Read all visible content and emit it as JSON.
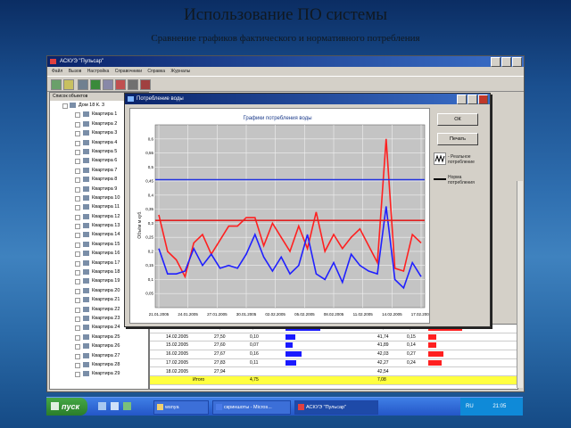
{
  "slide": {
    "title": "Использование ПО системы",
    "subtitle": "Сравнение графиков фактического и нормативного потребления"
  },
  "app": {
    "title": "АСКУЭ \"Пульсар\"",
    "menu": [
      "Файл",
      "Вызов",
      "Настройка",
      "Справочники",
      "Справка",
      "Журналы"
    ]
  },
  "tree": {
    "header": "Список объектов",
    "root": "Дом 18 К. 3",
    "items": [
      "Квартира 1",
      "Квартира 2",
      "Квартира 3",
      "Квартира 4",
      "Квартира 5",
      "Квартира 6",
      "Квартира 7",
      "Квартира 8",
      "Квартира 9",
      "Квартира 10",
      "Квартира 11",
      "Квартира 12",
      "Квартира 13",
      "Квартира 14",
      "Квартира 15",
      "Квартира 16",
      "Квартира 17",
      "Квартира 18",
      "Квартира 19",
      "Квартира 20",
      "Квартира 21",
      "Квартира 22",
      "Квартира 23",
      "Квартира 24",
      "Квартира 25",
      "Квартира 26",
      "Квартира 27",
      "Квартира 28",
      "Квартира 29"
    ]
  },
  "grid": {
    "rows": [
      {
        "date": "13.02.2005",
        "a": "27,15",
        "b": "0,35",
        "c": "41,13",
        "d": "0,61"
      },
      {
        "date": "14.02.2005",
        "a": "27,50",
        "b": "0,10",
        "c": "41,74",
        "d": "0,15"
      },
      {
        "date": "15.02.2005",
        "a": "27,60",
        "b": "0,07",
        "c": "41,89",
        "d": "0,14"
      },
      {
        "date": "16.02.2005",
        "a": "27,67",
        "b": "0,16",
        "c": "42,03",
        "d": "0,27"
      },
      {
        "date": "17.02.2005",
        "a": "27,83",
        "b": "0,11",
        "c": "42,27",
        "d": "0,24"
      },
      {
        "date": "18.02.2005",
        "a": "27,94",
        "b": "",
        "c": "42,54",
        "d": ""
      }
    ],
    "total_label": "Итого",
    "total_b": "4,75",
    "total_d": "7,08"
  },
  "dialog": {
    "title": "Потребление воды",
    "ok_label": "ОК",
    "print_label": "Печать",
    "legend_real": "- Реальное потребление",
    "legend_norm": "Норма потребления"
  },
  "chart_data": {
    "type": "line",
    "title": "Графики потребления воды",
    "ylabel": "Объём м куб.",
    "ylim": [
      0,
      0.65
    ],
    "y_ticks": [
      "0,05",
      "0,1",
      "0,15",
      "0,2",
      "0,25",
      "0,3",
      "0,35",
      "0,4",
      "0,45",
      "0,5",
      "0,55",
      "0,6"
    ],
    "x_ticks": [
      "21.01.2005",
      "24.01.2005",
      "27.01.2005",
      "30.01.2005",
      "02.02.2005",
      "05.02.2005",
      "08.02.2005",
      "11.02.2005",
      "14.02.2005",
      "17.02.2005"
    ],
    "grid": true,
    "series": [
      {
        "name": "Реальное потребление",
        "color": "#ff2020",
        "values": [
          0.33,
          0.2,
          0.17,
          0.11,
          0.23,
          0.26,
          0.19,
          0.24,
          0.29,
          0.29,
          0.32,
          0.32,
          0.22,
          0.3,
          0.25,
          0.2,
          0.29,
          0.21,
          0.34,
          0.2,
          0.26,
          0.21,
          0.25,
          0.28,
          0.22,
          0.16,
          0.6,
          0.14,
          0.13,
          0.26,
          0.23
        ]
      },
      {
        "name": "Норма потребления",
        "color": "#2020ff",
        "values": [
          0.21,
          0.12,
          0.12,
          0.13,
          0.21,
          0.15,
          0.19,
          0.14,
          0.15,
          0.14,
          0.19,
          0.26,
          0.18,
          0.13,
          0.18,
          0.12,
          0.15,
          0.26,
          0.12,
          0.1,
          0.16,
          0.09,
          0.19,
          0.15,
          0.13,
          0.12,
          0.36,
          0.1,
          0.07,
          0.16,
          0.11
        ]
      },
      {
        "name": "norm-high",
        "color": "#2030e0",
        "values": [
          0.455
        ]
      },
      {
        "name": "norm-low",
        "color": "#e02020",
        "values": [
          0.31
        ]
      }
    ]
  },
  "taskbar": {
    "start_label": "пуск",
    "tasks": [
      "wsnya",
      "скриншоты - Micros...",
      "АСКУЭ \"Пульсар\""
    ],
    "lang": "RU",
    "clock": "21:05"
  }
}
